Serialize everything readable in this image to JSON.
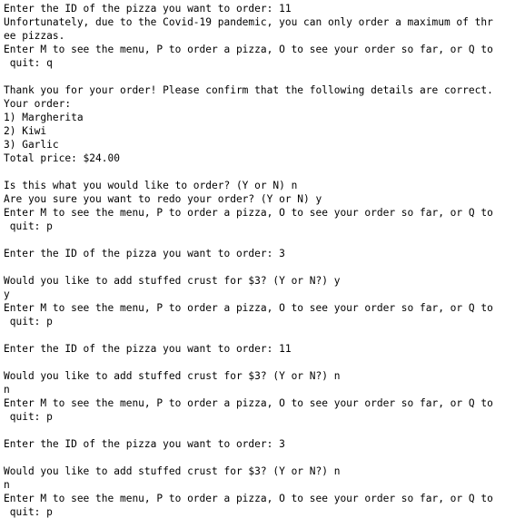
{
  "terminal": {
    "lines": [
      "Enter the ID of the pizza you want to order: 11",
      "Unfortunately, due to the Covid-19 pandemic, you can only order a maximum of thr",
      "ee pizzas.",
      "Enter M to see the menu, P to order a pizza, O to see your order so far, or Q to",
      " quit: q",
      "",
      "Thank you for your order! Please confirm that the following details are correct.",
      "Your order:",
      "1) Margherita",
      "2) Kiwi",
      "3) Garlic",
      "Total price: $24.00",
      "",
      "Is this what you would like to order? (Y or N) n",
      "Are you sure you want to redo your order? (Y or N) y",
      "Enter M to see the menu, P to order a pizza, O to see your order so far, or Q to",
      " quit: p",
      "",
      "Enter the ID of the pizza you want to order: 3",
      "",
      "Would you like to add stuffed crust for $3? (Y or N?) y",
      "y",
      "Enter M to see the menu, P to order a pizza, O to see your order so far, or Q to",
      " quit: p",
      "",
      "Enter the ID of the pizza you want to order: 11",
      "",
      "Would you like to add stuffed crust for $3? (Y or N?) n",
      "n",
      "Enter M to see the menu, P to order a pizza, O to see your order so far, or Q to",
      " quit: p",
      "",
      "Enter the ID of the pizza you want to order: 3",
      "",
      "Would you like to add stuffed crust for $3? (Y or N?) n",
      "n",
      "Enter M to see the menu, P to order a pizza, O to see your order so far, or Q to",
      " quit: p"
    ]
  }
}
